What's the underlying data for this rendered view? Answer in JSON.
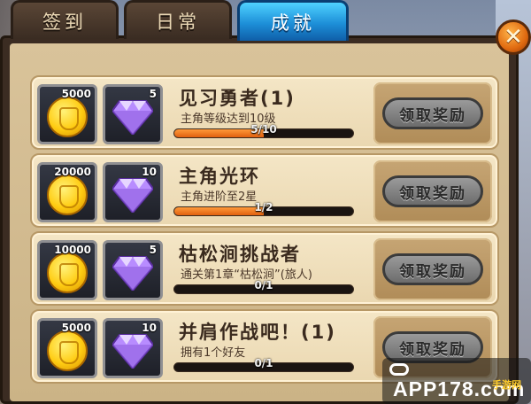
{
  "tabs": [
    {
      "label": "签到",
      "active": false
    },
    {
      "label": "日常",
      "active": false
    },
    {
      "label": "成就",
      "active": true
    }
  ],
  "close_label": "✕",
  "achievements": [
    {
      "gold": "5000",
      "gems": "5",
      "title": "见习勇者(1)",
      "desc": "主角等级达到10级",
      "progress": "5/10",
      "fill": 0.5,
      "claim": "领取奖励"
    },
    {
      "gold": "20000",
      "gems": "10",
      "title": "主角光环",
      "desc": "主角进阶至2星",
      "progress": "1/2",
      "fill": 0.5,
      "claim": "领取奖励"
    },
    {
      "gold": "10000",
      "gems": "5",
      "title": "枯松涧挑战者",
      "desc": "通关第1章“枯松涧”(旅人)",
      "progress": "0/1",
      "fill": 0,
      "claim": "领取奖励"
    },
    {
      "gold": "5000",
      "gems": "10",
      "title": "并肩作战吧！(1)",
      "desc": "拥有1个好友",
      "progress": "0/1",
      "fill": 0,
      "claim": "领取奖励"
    }
  ],
  "watermark": {
    "app": "APP178.com",
    "site": "手游网"
  },
  "colors": {
    "tab_active": "#1d8fd8",
    "progress_fill": "#e0600f",
    "card_bg": "#f4e6c6"
  }
}
